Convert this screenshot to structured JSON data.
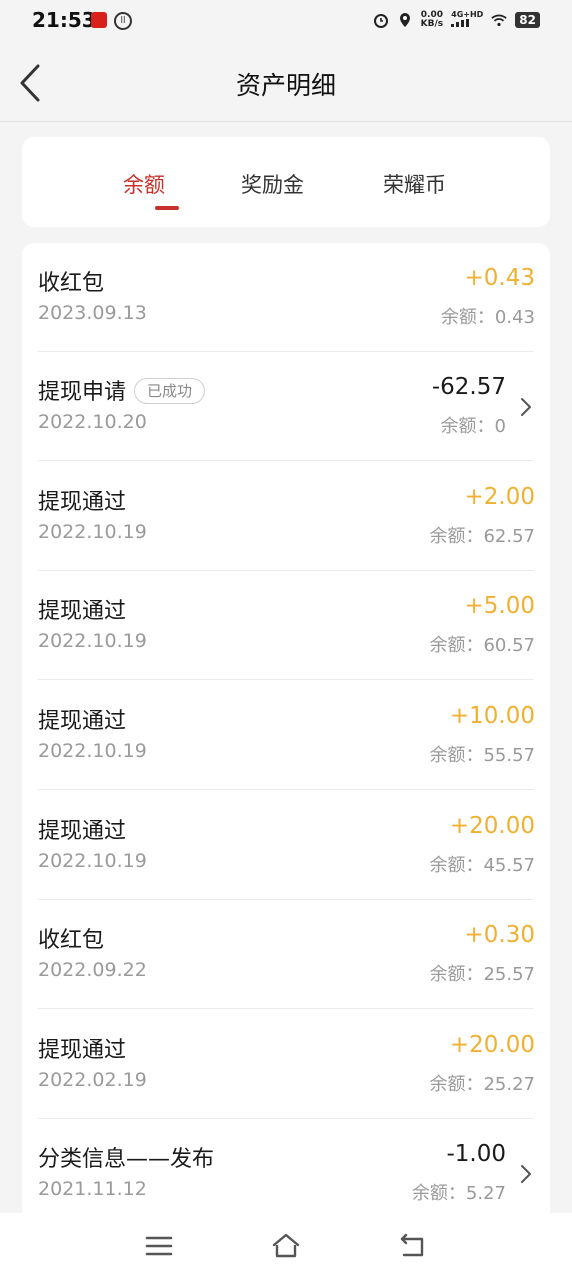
{
  "status_bar": {
    "time": "21:53",
    "speed_value": "0.00",
    "speed_unit": "KB/s",
    "network": "4G+HD",
    "battery": "82",
    "icons": [
      "app-icon",
      "ll-icon",
      "alarm-icon",
      "location-icon",
      "signal-icon",
      "wifi-icon",
      "battery-icon"
    ]
  },
  "header": {
    "title": "资产明细"
  },
  "tabs": [
    {
      "label": "余额",
      "active": true
    },
    {
      "label": "奖励金",
      "active": false
    },
    {
      "label": "荣耀币",
      "active": false
    }
  ],
  "transactions": [
    {
      "title": "收红包",
      "badge": "",
      "date": "2023.09.13",
      "amount": "+0.43",
      "balance": "余额：0.43",
      "type": "positive",
      "chevron": false
    },
    {
      "title": "提现申请",
      "badge": "已成功",
      "date": "2022.10.20",
      "amount": "-62.57",
      "balance": "余额：0",
      "type": "negative",
      "chevron": true
    },
    {
      "title": "提现通过",
      "badge": "",
      "date": "2022.10.19",
      "amount": "+2.00",
      "balance": "余额：62.57",
      "type": "positive",
      "chevron": false
    },
    {
      "title": "提现通过",
      "badge": "",
      "date": "2022.10.19",
      "amount": "+5.00",
      "balance": "余额：60.57",
      "type": "positive",
      "chevron": false
    },
    {
      "title": "提现通过",
      "badge": "",
      "date": "2022.10.19",
      "amount": "+10.00",
      "balance": "余额：55.57",
      "type": "positive",
      "chevron": false
    },
    {
      "title": "提现通过",
      "badge": "",
      "date": "2022.10.19",
      "amount": "+20.00",
      "balance": "余额：45.57",
      "type": "positive",
      "chevron": false
    },
    {
      "title": "收红包",
      "badge": "",
      "date": "2022.09.22",
      "amount": "+0.30",
      "balance": "余额：25.57",
      "type": "positive",
      "chevron": false
    },
    {
      "title": "提现通过",
      "badge": "",
      "date": "2022.02.19",
      "amount": "+20.00",
      "balance": "余额：25.27",
      "type": "positive",
      "chevron": false
    },
    {
      "title": "分类信息——发布",
      "badge": "",
      "date": "2021.11.12",
      "amount": "-1.00",
      "balance": "余额：5.27",
      "type": "negative",
      "chevron": true
    }
  ],
  "bottom_nav": [
    "menu-icon",
    "home-icon",
    "back-icon"
  ],
  "colors": {
    "accent": "#c8322b",
    "positive_amount": "#f0b030",
    "background": "#f4f4f4"
  }
}
